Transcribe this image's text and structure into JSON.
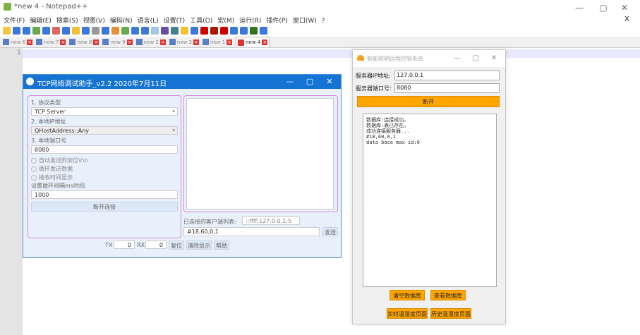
{
  "npp": {
    "title": "*new 4 - Notepad++",
    "window_controls": [
      "—",
      "▢",
      "✕"
    ],
    "menu": [
      "文件(F)",
      "编辑(E)",
      "搜索(S)",
      "视图(V)",
      "编码(N)",
      "语言(L)",
      "设置(T)",
      "工具(O)",
      "宏(M)",
      "运行(R)",
      "插件(P)",
      "窗口(W)",
      "?"
    ],
    "close_x": "X",
    "toolbar_colors": [
      "#f5c542",
      "#3b78d8",
      "#3b78d8",
      "#6aa84f",
      "#3b78d8",
      "#e06666",
      "#3b78d8",
      "#f1c232",
      "#3b78d8",
      "#999999",
      "#3b78d8",
      "#e69138",
      "#6aa84f",
      "#3b78d8",
      "#3b78d8",
      "#9fc5e8",
      "#674ea7",
      "#45818e",
      "#f1c232",
      "#3b78d8",
      "#cc0000",
      "#a61c00",
      "#cc0000",
      "#3b78d8",
      "#3b78d8",
      "#38761d",
      "#3b78d8"
    ],
    "tabs": [
      {
        "label": "new 6",
        "active": false
      },
      {
        "label": "new 7",
        "active": false
      },
      {
        "label": "new 8",
        "active": false
      },
      {
        "label": "new 9",
        "active": false
      },
      {
        "label": "new 2",
        "active": false
      },
      {
        "label": "new 3",
        "active": false
      },
      {
        "label": "new 1",
        "active": false
      },
      {
        "label": "new 4",
        "active": true
      }
    ],
    "line_number": "1"
  },
  "tcp": {
    "title": "TCP网络调试助手_v2.2 2020年7月11日",
    "controls": [
      "—",
      "▢",
      "✕"
    ],
    "protocol_label": "1. 协议类型",
    "protocol_value": "TCP Server",
    "local_ip_label": "2. 本地IP地址",
    "local_ip_value": "QHostAddress::Any",
    "local_port_label": "3. 本地端口号",
    "local_port_value": "8080",
    "opt_auto_newline": "自动发送附加位\\r\\n",
    "opt_loop_send": "循环发送数据",
    "opt_hex_recv": "接收时间显示",
    "loop_interval_label": "设置循环间隔ms时间:",
    "loop_interval_value": "1000",
    "disconnect_btn": "断开连接",
    "clients_label": "已连接的客户端列表:",
    "clients_value": "::ffff:127.0.0.1:5",
    "send_value": "#18,60,0,1",
    "send_btn": "发送",
    "tx_label": "TX",
    "tx_value": "0",
    "rx_label": "RX",
    "rx_value": "0",
    "reset_btn": "复位",
    "clear_btn": "清除显示",
    "help_btn": "帮助"
  },
  "rc": {
    "title": "智能照明远程控制系统",
    "controls": [
      "—",
      "▢",
      "✕"
    ],
    "server_ip_label": "服务器IP地址:",
    "server_ip_value": "127.0.0.1",
    "server_port_label": "服务器端口号:",
    "server_port_value": "8080",
    "disconnect_btn": "断开",
    "log_lines": [
      "数据库:连接成功。",
      "数据库:表已存在。",
      "成功连接服务器...",
      "#18,60,0,1",
      "data base max id:0"
    ],
    "clear_db_btn": "清空数据库",
    "view_db_btn": "查看数据库",
    "realtime_btn": "实时温湿度页面",
    "history_btn": "历史温湿度页面"
  }
}
